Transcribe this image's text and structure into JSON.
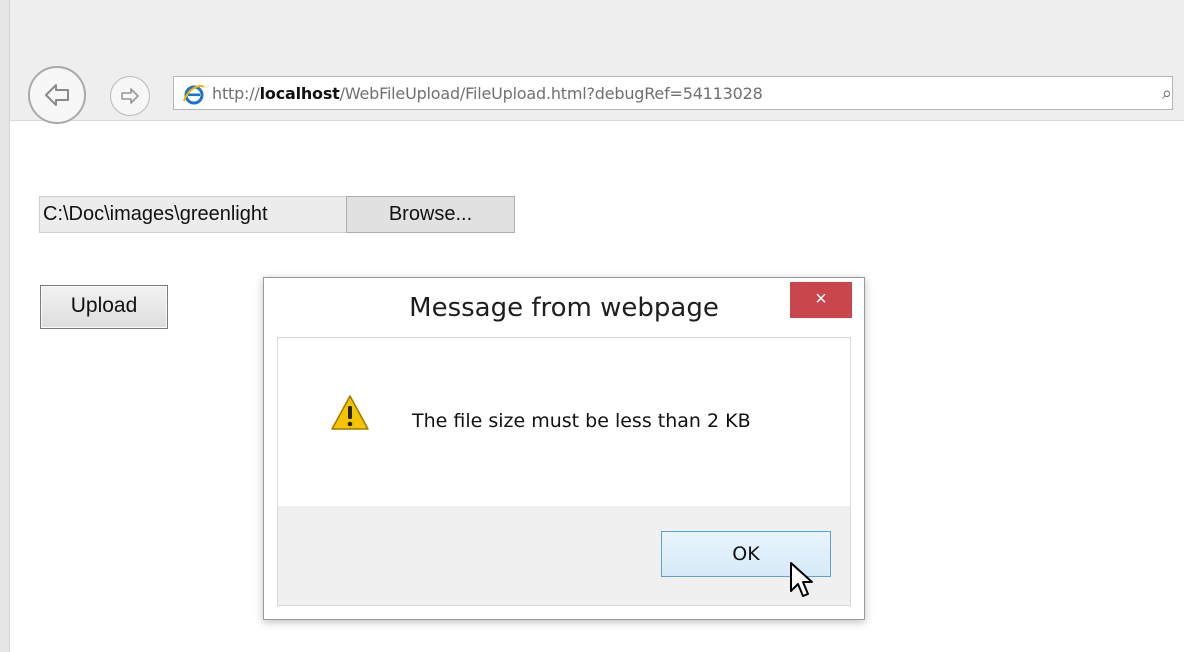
{
  "browser": {
    "url_prefix": "http://",
    "url_host": "localhost",
    "url_path": "/WebFileUpload/FileUpload.html?debugRef=54113028"
  },
  "page": {
    "file_path_value": "C:\\Doc\\images\\greenlight",
    "browse_label": "Browse...",
    "upload_label": "Upload"
  },
  "dialog": {
    "title": "Message from webpage",
    "close_glyph": "×",
    "message": "The file size must be less than 2 KB",
    "ok_label": "OK"
  },
  "icons": {
    "back": "back-arrow-icon",
    "forward": "forward-arrow-icon",
    "browser": "internet-explorer-icon",
    "search": "search-icon",
    "warning": "warning-icon",
    "cursor": "mouse-pointer-icon"
  },
  "colors": {
    "close_button": "#c9464c",
    "ok_border": "#5ea3d6",
    "warning_fill": "#f5c400"
  }
}
